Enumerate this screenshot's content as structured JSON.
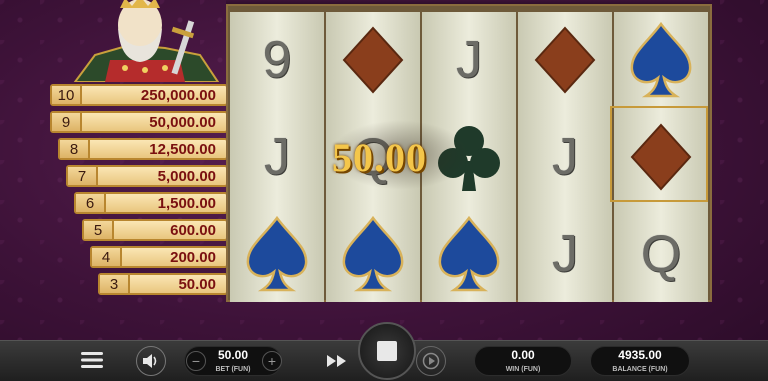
{
  "paytable": [
    {
      "count": "10",
      "payout": "250,000.00"
    },
    {
      "count": "9",
      "payout": "50,000.00"
    },
    {
      "count": "8",
      "payout": "12,500.00"
    },
    {
      "count": "7",
      "payout": "5,000.00"
    },
    {
      "count": "6",
      "payout": "1,500.00"
    },
    {
      "count": "5",
      "payout": "600.00"
    },
    {
      "count": "4",
      "payout": "200.00"
    },
    {
      "count": "3",
      "payout": "50.00"
    }
  ],
  "reels": [
    [
      "9",
      "J",
      "spade"
    ],
    [
      "diamond",
      "Q",
      "spade"
    ],
    [
      "J",
      "club",
      "spade"
    ],
    [
      "diamond",
      "J",
      "J"
    ],
    [
      "spade",
      "diamond",
      "Q"
    ]
  ],
  "win_amount": "50.00",
  "bottom_bar": {
    "bet_value": "50.00",
    "bet_label": "BET (FUN)",
    "win_value": "0.00",
    "win_label": "WIN (FUN)",
    "balance_value": "4935.00",
    "balance_label": "BALANCE (FUN)"
  },
  "colors": {
    "background": "#3d1238",
    "paytable_value": "#7a1010",
    "win_gold": "#f4c64a",
    "spade_blue": "#1d4a9c",
    "diamond_brown": "#8a3e1c",
    "club_green": "#1f3a2a"
  }
}
